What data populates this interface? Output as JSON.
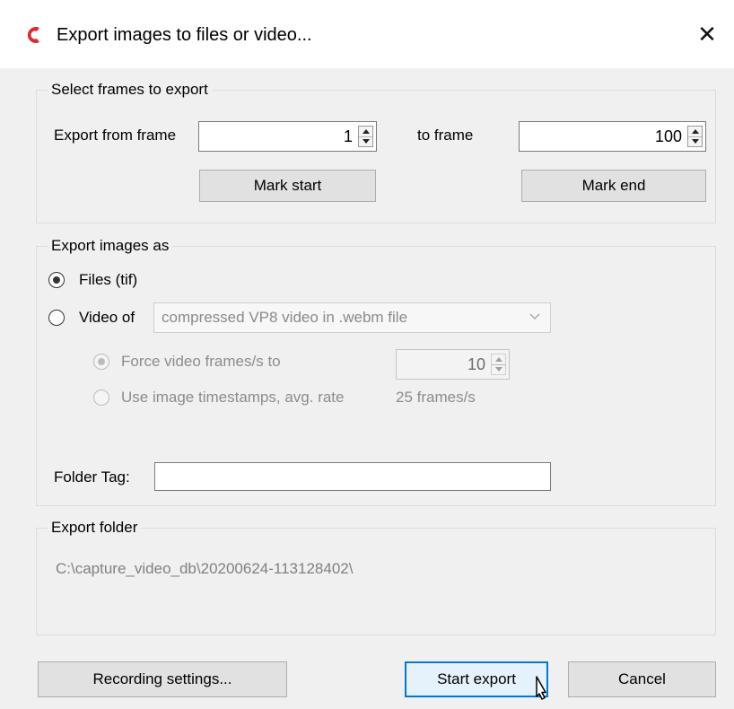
{
  "window": {
    "title": "Export images to files or video...",
    "close_glyph": "✕",
    "app_icon": "app-logo-icon",
    "accent_color": "#d92b2b"
  },
  "frames_group": {
    "title": "Select frames to export",
    "from_label": "Export from frame",
    "from_value": "1",
    "to_label": "to frame",
    "to_value": "100",
    "mark_start": "Mark start",
    "mark_end": "Mark end"
  },
  "export_as_group": {
    "title": "Export images as",
    "files_option": "Files (tif)",
    "video_option": "Video of",
    "video_format": "compressed VP8 video in .webm file",
    "force_fps_label": "Force video frames/s to",
    "force_fps_value": "10",
    "timestamps_label": "Use image timestamps, avg. rate",
    "timestamps_rate": "25 frames/s",
    "folder_tag_label": "Folder Tag:",
    "folder_tag_value": ""
  },
  "export_folder_group": {
    "title": "Export folder",
    "path": "C:\\capture_video_db\\20200624-113128402\\"
  },
  "footer": {
    "recording_settings": "Recording settings...",
    "start_export": "Start export",
    "cancel": "Cancel"
  }
}
